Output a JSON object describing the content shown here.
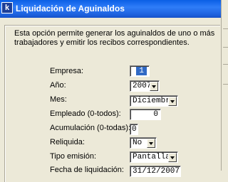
{
  "window": {
    "icon_glyph": "k",
    "icon_name": "app-logo-icon",
    "title": "Liquidación de Aguinaldos"
  },
  "description": "Esta opción permite generar los aguinaldos de uno o más trabajadores y emitir los recibos correspondientes.",
  "form": {
    "empresa": {
      "label": "Empresa:",
      "value": "1"
    },
    "anio": {
      "label": "Año:",
      "value": "2007"
    },
    "mes": {
      "label": "Mes:",
      "value": "Diciembre"
    },
    "empleado": {
      "label": "Empleado (0-todos):",
      "value": "0"
    },
    "acumulacion": {
      "label": "Acumulación (0-todas):",
      "value": "0"
    },
    "reliquida": {
      "label": "Reliquida:",
      "value": "No"
    },
    "tipo_emision": {
      "label": "Tipo emisión:",
      "value": "Pantalla"
    },
    "fecha_liquidacion": {
      "label": "Fecha de liquidación:",
      "value": "31/12/2007"
    }
  },
  "colors": {
    "titlebar": "#2f7df8",
    "window_bg": "#ece9d8",
    "selection": "#316ac5"
  }
}
